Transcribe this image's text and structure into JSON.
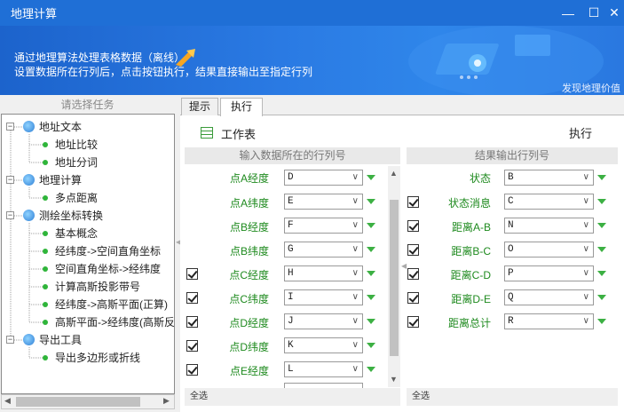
{
  "window": {
    "title": "地理计算",
    "min_icon": "minimize-icon",
    "max_icon": "maximize-icon",
    "close_icon": "close-icon"
  },
  "banner": {
    "line1": "通过地理算法处理表格数据（离线）",
    "line2": "设置数据所在行列后，点击按钮执行，结果直接输出至指定行列",
    "slogan": "发现地理价值"
  },
  "left_panel": {
    "header": "请选择任务",
    "tree": [
      {
        "label": "地址文本",
        "level": 0,
        "expanded": true
      },
      {
        "label": "地址比较",
        "level": 1
      },
      {
        "label": "地址分词",
        "level": 1
      },
      {
        "label": "地理计算",
        "level": 0,
        "expanded": true
      },
      {
        "label": "多点距离",
        "level": 1
      },
      {
        "label": "测绘坐标转换",
        "level": 0,
        "expanded": true
      },
      {
        "label": "基本概念",
        "level": 1
      },
      {
        "label": "经纬度->空间直角坐标",
        "level": 1
      },
      {
        "label": "空间直角坐标->经纬度",
        "level": 1
      },
      {
        "label": "计算高斯投影带号",
        "level": 1
      },
      {
        "label": "经纬度->高斯平面(正算)",
        "level": 1
      },
      {
        "label": "高斯平面->经纬度(高斯反",
        "level": 1
      },
      {
        "label": "导出工具",
        "level": 0,
        "expanded": true
      },
      {
        "label": "导出多边形或折线",
        "level": 1
      }
    ]
  },
  "tabs": [
    {
      "label": "提示",
      "active": false
    },
    {
      "label": "执行",
      "active": true
    }
  ],
  "toolbar": {
    "sheet_label": "工作表",
    "exec_label": "执行"
  },
  "input_section": {
    "header": "输入数据所在的行列号",
    "rows": [
      {
        "label": "点A经度",
        "value": "D",
        "checkbox": false
      },
      {
        "label": "点A纬度",
        "value": "E",
        "checkbox": false
      },
      {
        "label": "点B经度",
        "value": "F",
        "checkbox": false
      },
      {
        "label": "点B纬度",
        "value": "G",
        "checkbox": false
      },
      {
        "label": "点C经度",
        "value": "H",
        "checkbox": true
      },
      {
        "label": "点C纬度",
        "value": "I",
        "checkbox": true
      },
      {
        "label": "点D经度",
        "value": "J",
        "checkbox": true
      },
      {
        "label": "点D纬度",
        "value": "K",
        "checkbox": true
      },
      {
        "label": "点E经度",
        "value": "L",
        "checkbox": true
      }
    ],
    "footer": "全选"
  },
  "output_section": {
    "header": "结果输出行列号",
    "rows": [
      {
        "label": "状态",
        "value": "B",
        "checkbox": false
      },
      {
        "label": "状态消息",
        "value": "C",
        "checkbox": true
      },
      {
        "label": "距离A-B",
        "value": "N",
        "checkbox": true
      },
      {
        "label": "距离B-C",
        "value": "O",
        "checkbox": true
      },
      {
        "label": "距离C-D",
        "value": "P",
        "checkbox": true
      },
      {
        "label": "距离D-E",
        "value": "Q",
        "checkbox": true
      },
      {
        "label": "距离总计",
        "value": "R",
        "checkbox": true
      }
    ],
    "footer": "全选"
  },
  "colors": {
    "title_bar": "#1f6fd6",
    "label_green": "#1e8a1e",
    "arrow_green": "#3cb043"
  }
}
